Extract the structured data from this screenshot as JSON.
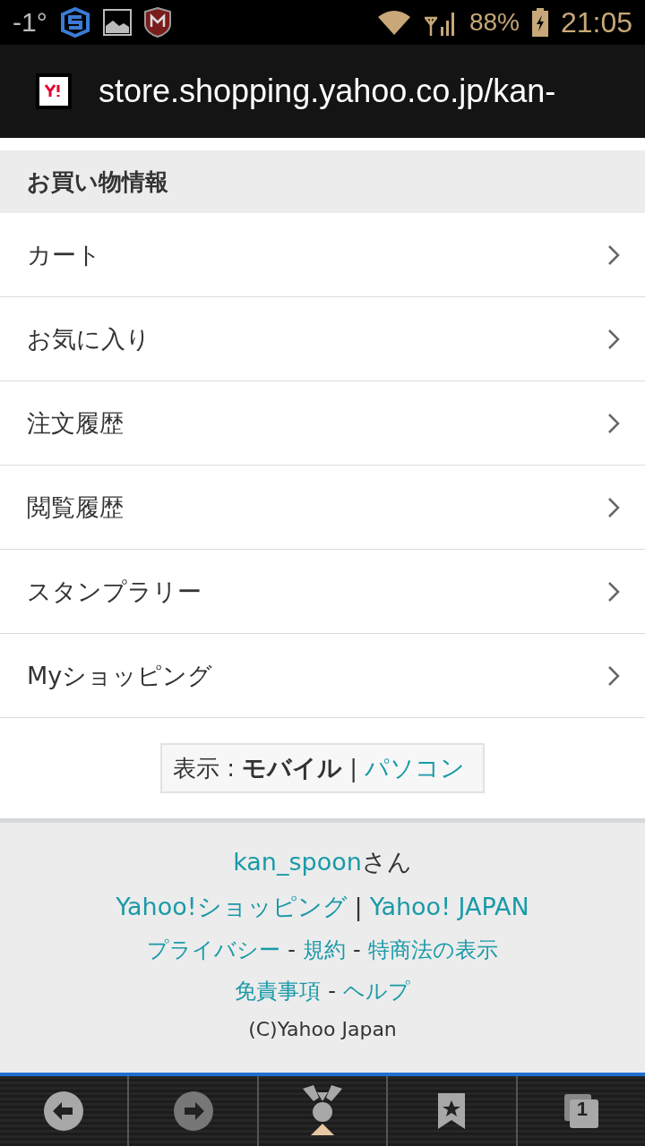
{
  "status_bar": {
    "temperature": "-1°",
    "battery": "88%",
    "time": "21:05"
  },
  "address_bar": {
    "url": "store.shopping.yahoo.co.jp/kan-"
  },
  "section": {
    "title": "お買い物情報"
  },
  "menu_items": [
    {
      "label": "カート"
    },
    {
      "label": "お気に入り"
    },
    {
      "label": "注文履歴"
    },
    {
      "label": "閲覧履歴"
    },
    {
      "label": "スタンプラリー"
    },
    {
      "label": "Myショッピング"
    }
  ],
  "view_switch": {
    "label": "表示 :",
    "separator": "|",
    "options": [
      {
        "label": "モバイル",
        "selected": true
      },
      {
        "label": "パソコン",
        "selected": false
      }
    ]
  },
  "footer": {
    "user": {
      "name": "kan_spoon",
      "suffix": "さん"
    },
    "link_rows": [
      {
        "separator": "|",
        "links": [
          "Yahoo!ショッピング",
          "Yahoo! JAPAN"
        ]
      },
      {
        "separator": "-",
        "links": [
          "プライバシー",
          "規約",
          "特商法の表示"
        ]
      },
      {
        "separator": "-",
        "links": [
          "免責事項",
          "ヘルプ"
        ]
      }
    ],
    "copyright": "(C)Yahoo Japan"
  },
  "toolbar": {
    "buttons": [
      {
        "kind": "back",
        "disabled": false
      },
      {
        "kind": "forward",
        "disabled": true
      },
      {
        "kind": "menu",
        "disabled": false
      },
      {
        "kind": "bookmarks",
        "disabled": false
      },
      {
        "kind": "tabs",
        "disabled": false,
        "count": "1"
      }
    ]
  }
}
